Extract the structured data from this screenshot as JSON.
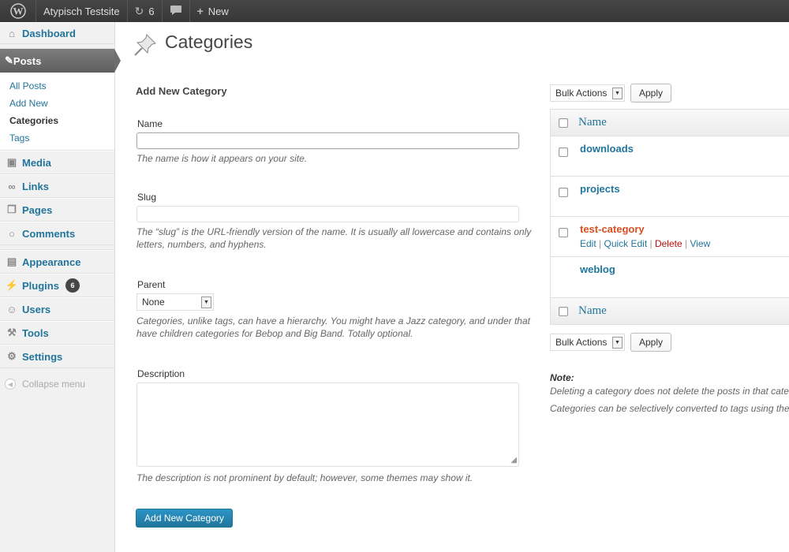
{
  "adminbar": {
    "site_name": "Atypisch Testsite",
    "updates_count": "6",
    "new_label": "New"
  },
  "sidebar": {
    "dashboard": "Dashboard",
    "posts": "Posts",
    "posts_submenu": [
      "All Posts",
      "Add New",
      "Categories",
      "Tags"
    ],
    "media": "Media",
    "links": "Links",
    "pages": "Pages",
    "comments": "Comments",
    "appearance": "Appearance",
    "plugins": "Plugins",
    "plugins_badge": "6",
    "users": "Users",
    "tools": "Tools",
    "settings": "Settings",
    "collapse": "Collapse menu"
  },
  "page": {
    "title": "Categories"
  },
  "form": {
    "heading": "Add New Category",
    "name_label": "Name",
    "name_value": "",
    "name_help": "The name is how it appears on your site.",
    "slug_label": "Slug",
    "slug_value": "",
    "slug_help": "The “slug” is the URL-friendly version of the name. It is usually all lowercase and contains only letters, numbers, and hyphens.",
    "parent_label": "Parent",
    "parent_value": "None",
    "parent_help": "Categories, unlike tags, can have a hierarchy. You might have a Jazz category, and under that have children categories for Bebop and Big Band. Totally optional.",
    "description_label": "Description",
    "description_value": "",
    "description_help": "The description is not prominent by default; however, some themes may show it.",
    "submit_label": "Add New Category"
  },
  "table": {
    "bulk_actions": "Bulk Actions",
    "apply": "Apply",
    "column_name": "Name",
    "rows": [
      {
        "name": "downloads"
      },
      {
        "name": "projects"
      },
      {
        "name": "test-category"
      },
      {
        "name": "weblog"
      }
    ],
    "row_actions": {
      "edit": "Edit",
      "quick_edit": "Quick Edit",
      "delete": "Delete",
      "view": "View",
      "separator": " | "
    }
  },
  "notes": {
    "label": "Note:",
    "line1": "Deleting a category does not delete the posts in that cate",
    "line2": "Categories can be selectively converted to tags using the"
  },
  "colors": {
    "link": "#21759b",
    "hover": "#d54e21",
    "delete": "#bc0b0b",
    "adminbar": "#464646"
  }
}
